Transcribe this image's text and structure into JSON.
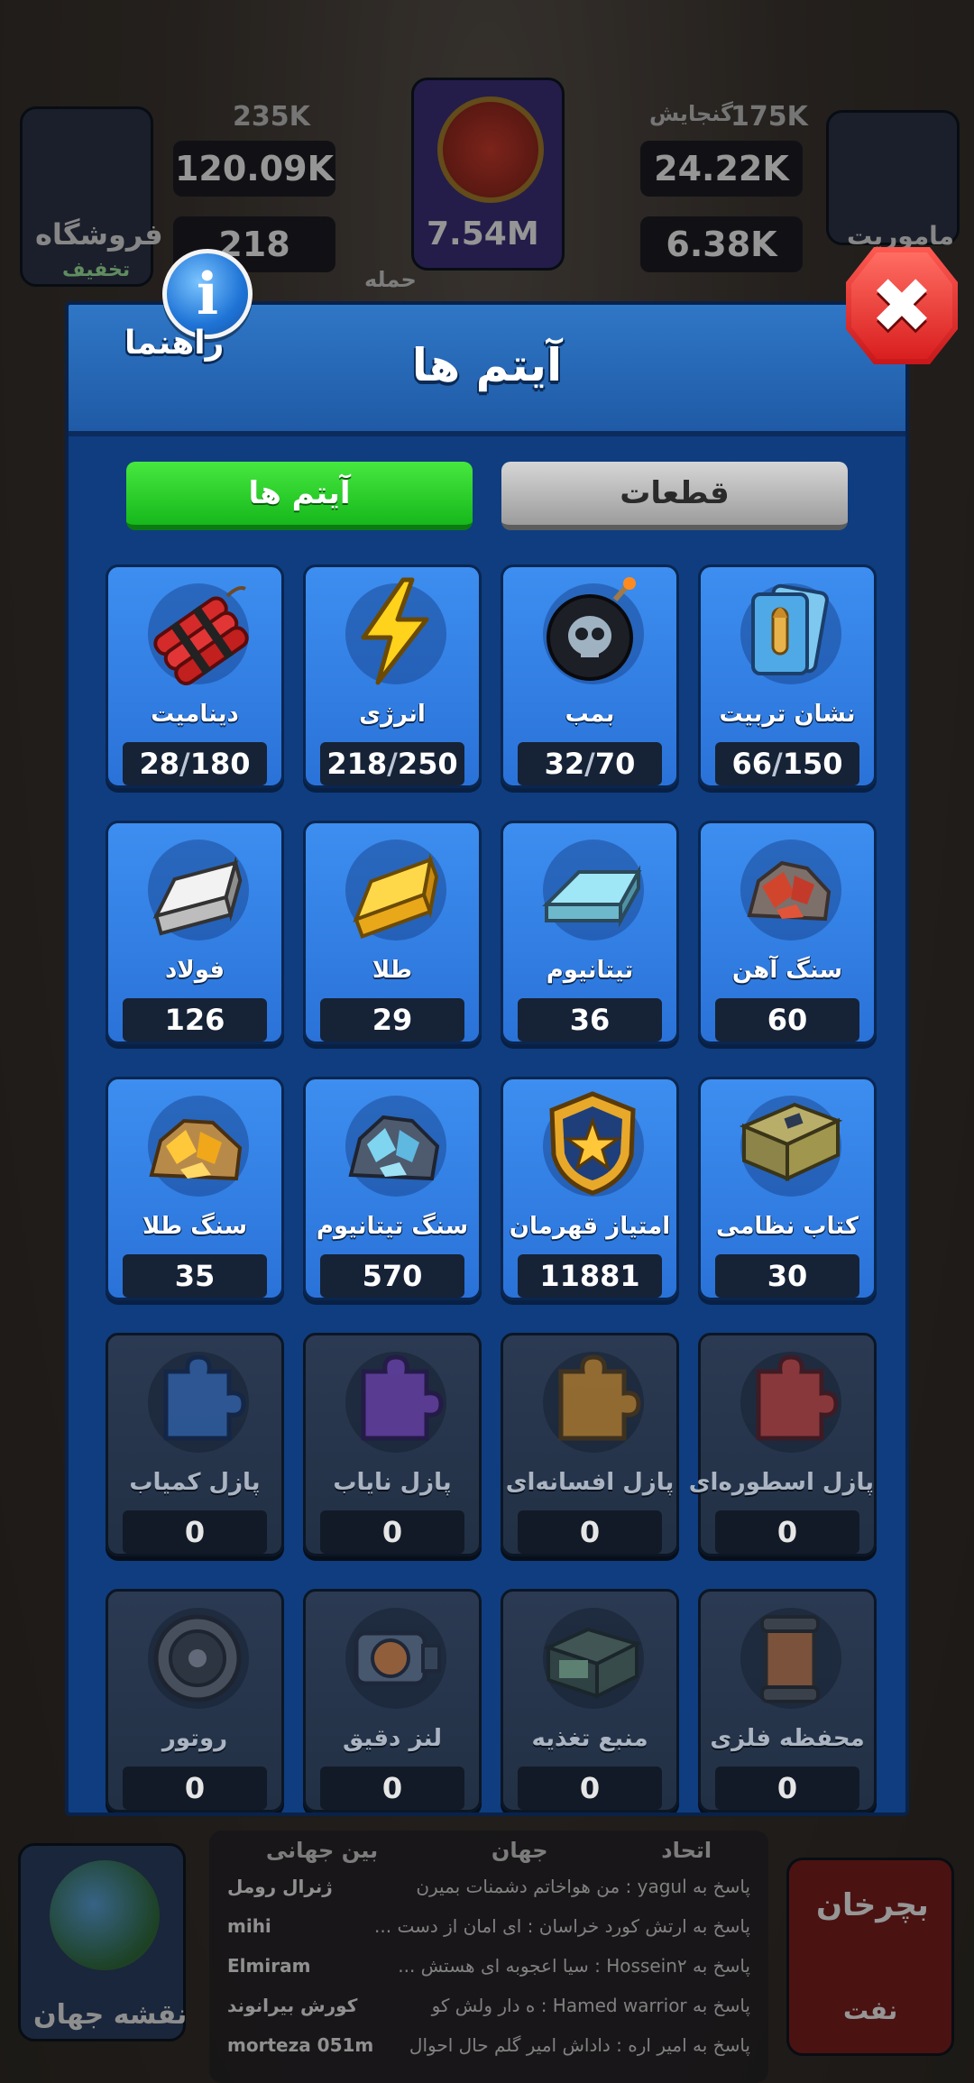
{
  "background": {
    "shop_label": "فروشگاه",
    "shop_badge": "تخفیف",
    "missions_label": "ماموریت",
    "treasury_label": "گنجایش",
    "treasury_value": "175K",
    "left_cap_value": "235K",
    "res_left_top": "120.09K",
    "res_left_bottom": "218",
    "power_value": "7.54M",
    "attack_label": "حمله",
    "res_right_top": "24.22K",
    "res_right_bottom": "6.38K",
    "world_map_label": "نقشه جهان",
    "spin_label": "بچرخان",
    "oil_label": "نفت",
    "chat_tabs": [
      "اتحاد",
      "جهان",
      "بین جهانی"
    ],
    "chat_lines": [
      {
        "text": "پاسخ به yagul : من هواخاتم دشمنات بمیرن",
        "who": "ژنرال رومل"
      },
      {
        "text": "پاسخ به ارتش کورد خراسان : ای امان از دست ...",
        "who": "mihi"
      },
      {
        "text": "پاسخ به Hossein۲ : سیا اعجوبه ای هستش ...",
        "who": "Elmiram"
      },
      {
        "text": "پاسخ به Hamed warrior : ه دار ولش کو",
        "who": "کورش بیرانوند"
      },
      {
        "text": "پاسخ به امیر اره : داداش امیر گلم حال احوال",
        "who": "morteza 051m"
      }
    ]
  },
  "modal": {
    "title": "آیتم ها",
    "help_label": "راهنما",
    "close_symbol": "✖",
    "tabs": {
      "parts": "قطعات",
      "items": "آیتم ها"
    },
    "items": [
      {
        "name": "نشان تربیت",
        "icon": "training-badge-cards-icon",
        "count": "66",
        "max": "150",
        "locked": false
      },
      {
        "name": "بمب",
        "icon": "skull-bomb-icon",
        "count": "32",
        "max": "70",
        "locked": false
      },
      {
        "name": "انرژی",
        "icon": "lightning-bolt-icon",
        "count": "218",
        "max": "250",
        "locked": false
      },
      {
        "name": "دینامیت",
        "icon": "dynamite-icon",
        "count": "28",
        "max": "180",
        "locked": false
      },
      {
        "name": "سنگ آهن",
        "icon": "iron-ore-icon",
        "count": "60",
        "max": "",
        "locked": false
      },
      {
        "name": "تیتانیوم",
        "icon": "titanium-ingot-icon",
        "count": "36",
        "max": "",
        "locked": false
      },
      {
        "name": "طلا",
        "icon": "gold-ingot-icon",
        "count": "29",
        "max": "",
        "locked": false
      },
      {
        "name": "فولاد",
        "icon": "steel-ingot-icon",
        "count": "126",
        "max": "",
        "locked": false
      },
      {
        "name": "کتاب نظامی",
        "icon": "military-book-icon",
        "count": "30",
        "max": "",
        "locked": false
      },
      {
        "name": "امتیاز قهرمان",
        "icon": "hero-star-badge-icon",
        "count": "11881",
        "max": "",
        "locked": false
      },
      {
        "name": "سنگ تیتانیوم",
        "icon": "titanium-ore-icon",
        "count": "570",
        "max": "",
        "locked": false
      },
      {
        "name": "سنگ طلا",
        "icon": "gold-ore-icon",
        "count": "35",
        "max": "",
        "locked": false
      },
      {
        "name": "پازل اسطوره‌ای",
        "icon": "puzzle-red-icon",
        "count": "0",
        "max": "",
        "locked": true
      },
      {
        "name": "پازل افسانه‌ای",
        "icon": "puzzle-orange-icon",
        "count": "0",
        "max": "",
        "locked": true
      },
      {
        "name": "پازل نایاب",
        "icon": "puzzle-purple-icon",
        "count": "0",
        "max": "",
        "locked": true
      },
      {
        "name": "پازل کمیاب",
        "icon": "puzzle-blue-icon",
        "count": "0",
        "max": "",
        "locked": true
      },
      {
        "name": "محفظه فلزی",
        "icon": "metal-canister-icon",
        "count": "0",
        "max": "",
        "locked": true
      },
      {
        "name": "منبع تغذیه",
        "icon": "power-supply-icon",
        "count": "0",
        "max": "",
        "locked": true
      },
      {
        "name": "لنز دقیق",
        "icon": "precision-lens-icon",
        "count": "0",
        "max": "",
        "locked": true
      },
      {
        "name": "روتور",
        "icon": "rotor-icon",
        "count": "0",
        "max": "",
        "locked": true
      }
    ]
  },
  "colors": {
    "modal_bg": "#0f3d80",
    "card_bg": "#3d8ef0",
    "tab_active": "#16b81c",
    "close_red": "#d91f1f"
  }
}
